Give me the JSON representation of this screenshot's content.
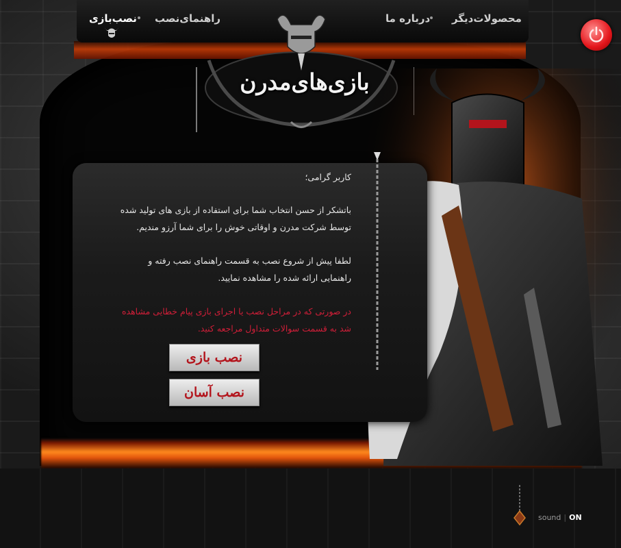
{
  "nav": {
    "install_game": "نصب‌بازی",
    "install_guide": "راهنمای‌نصب",
    "about": "درباره ما",
    "other_products": "محصولات‌دیگر"
  },
  "logo": {
    "title": "بازی‌های‌مدرن"
  },
  "message": {
    "greeting": "کاربر گرامی؛",
    "p1_line1": "باتشکر از حسن انتخاب شما برای استفاده از بازی های تولید شده",
    "p1_line2": "توسط شرکت مدرن و اوقاتی خوش را برای شما آرزو مندیم.",
    "p2_line1": "لطفا پیش از شروع نصب به قسمت راهنمای نصب رفته و",
    "p2_line2": "راهنمایی ارائه شده را مشاهده نمایید.",
    "p3_line1": "در صورتی که در مراحل نصب یا اجرای بازی پیام خطایی مشاهده",
    "p3_line2": "شد به قسمت سوالات متداول مراجعه کنید."
  },
  "buttons": {
    "install_game": "نصب بازی",
    "easy_install": "نصب آسان"
  },
  "sound": {
    "label": "sound",
    "separator": "|",
    "state": "ON"
  },
  "colors": {
    "accent_red": "#d01e38",
    "button_text": "#b3141c",
    "power_red": "#e4161c"
  },
  "icons": [
    "power-icon",
    "horned-helmet-icon",
    "knight-illustration",
    "chain-icon",
    "pendant-icon"
  ]
}
